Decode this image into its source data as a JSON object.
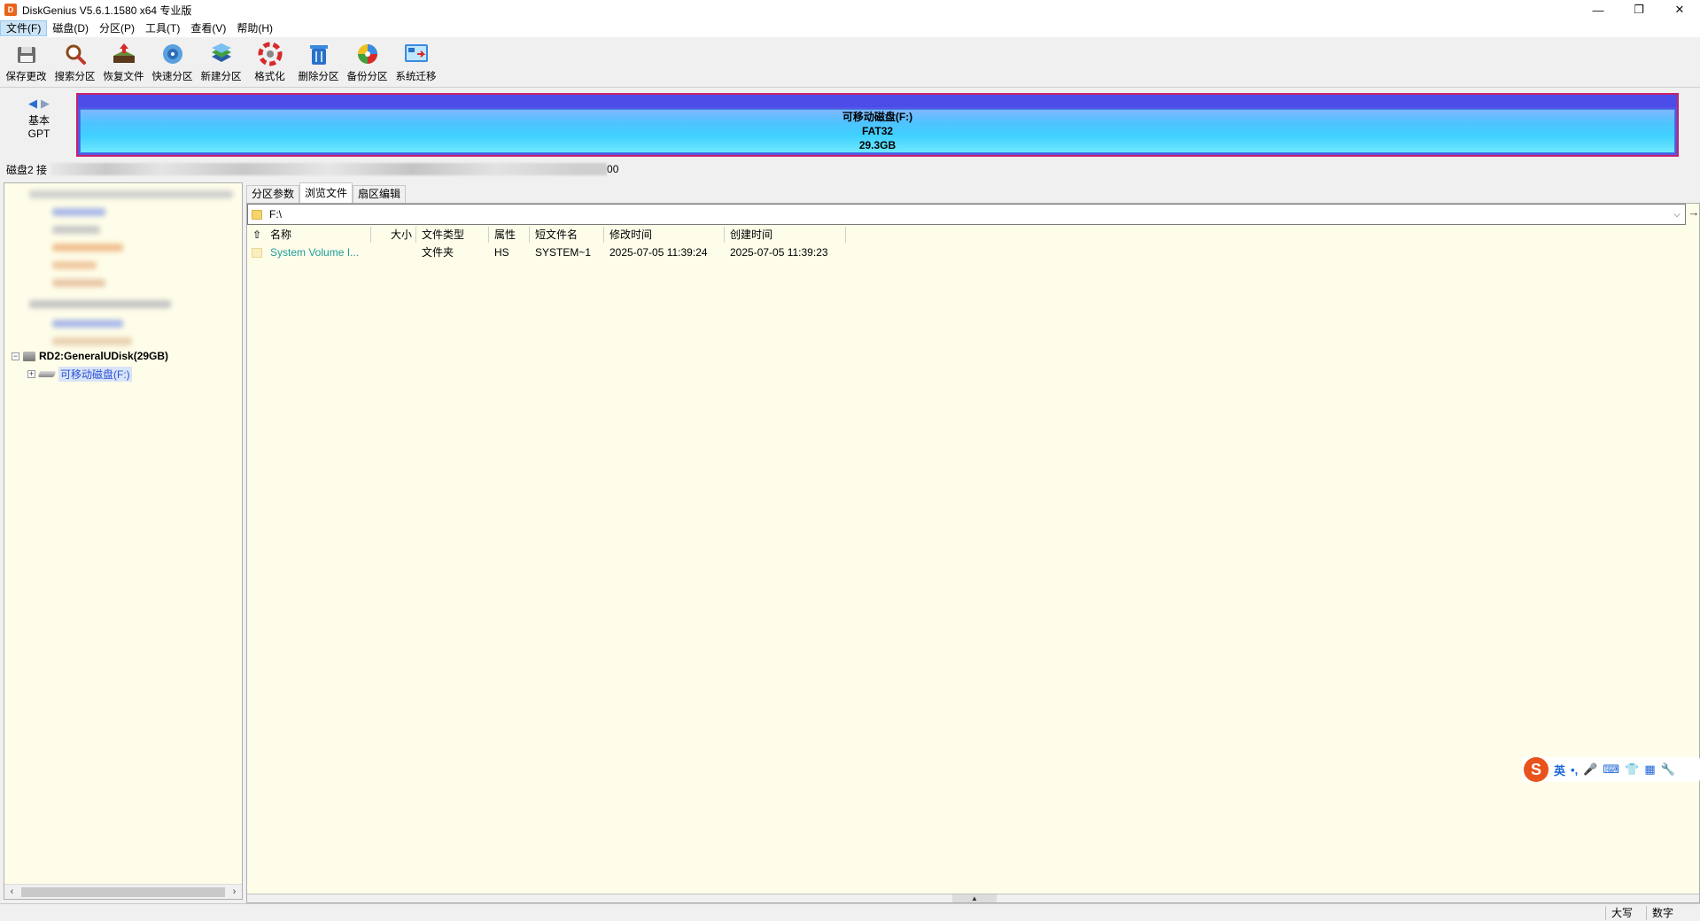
{
  "window": {
    "title": "DiskGenius V5.6.1.1580 x64 专业版",
    "app_icon_text": "D",
    "controls": {
      "minimize": "—",
      "restore": "❐",
      "close": "✕"
    }
  },
  "menu": [
    {
      "label": "文件(F)"
    },
    {
      "label": "磁盘(D)"
    },
    {
      "label": "分区(P)"
    },
    {
      "label": "工具(T)"
    },
    {
      "label": "查看(V)"
    },
    {
      "label": "帮助(H)"
    }
  ],
  "toolbar": [
    {
      "label": "保存更改",
      "icon": "save-icon"
    },
    {
      "label": "搜索分区",
      "icon": "search-icon"
    },
    {
      "label": "恢复文件",
      "icon": "restore-files-icon"
    },
    {
      "label": "快速分区",
      "icon": "quick-partition-icon"
    },
    {
      "label": "新建分区",
      "icon": "new-partition-icon"
    },
    {
      "label": "格式化",
      "icon": "format-icon"
    },
    {
      "label": "删除分区",
      "icon": "delete-partition-icon"
    },
    {
      "label": "备份分区",
      "icon": "backup-partition-icon"
    },
    {
      "label": "系统迁移",
      "icon": "system-migration-icon"
    }
  ],
  "disk_nav": {
    "line1": "基本",
    "line2": "GPT"
  },
  "disk_bar": {
    "name": "可移动磁盘(F:)",
    "fs": "FAT32",
    "size": "29.3GB",
    "border_color": "#c7226b"
  },
  "disk_info": {
    "prefix": "磁盘2 接",
    "suffix": "00"
  },
  "tree": {
    "disk_label": "RD2:GeneralUDisk(29GB)",
    "partition_label": "可移动磁盘(F:)",
    "collapse_glyph": "−",
    "expand_glyph": "+"
  },
  "tabs": [
    {
      "label": "分区参数",
      "active": false
    },
    {
      "label": "浏览文件",
      "active": true
    },
    {
      "label": "扇区编辑",
      "active": false
    }
  ],
  "path": {
    "value": "F:\\"
  },
  "columns": {
    "up": "⇧",
    "name": "名称",
    "size": "大小",
    "type": "文件类型",
    "attr": "属性",
    "short": "短文件名",
    "modified": "修改时间",
    "created": "创建时间"
  },
  "files": [
    {
      "name": "System Volume I...",
      "size": "",
      "type": "文件夹",
      "attr": "HS",
      "short": "SYSTEM~1",
      "modified": "2025-07-05 11:39:24",
      "created": "2025-07-05 11:39:23"
    }
  ],
  "ime": {
    "logo": "S",
    "mode": "英",
    "punct": "•,",
    "mic": "🎤",
    "keyboard": "⌨",
    "skin": "👕",
    "apps": "▦",
    "tools": "🔧"
  },
  "status": {
    "caps": "大写",
    "num": "数字"
  }
}
